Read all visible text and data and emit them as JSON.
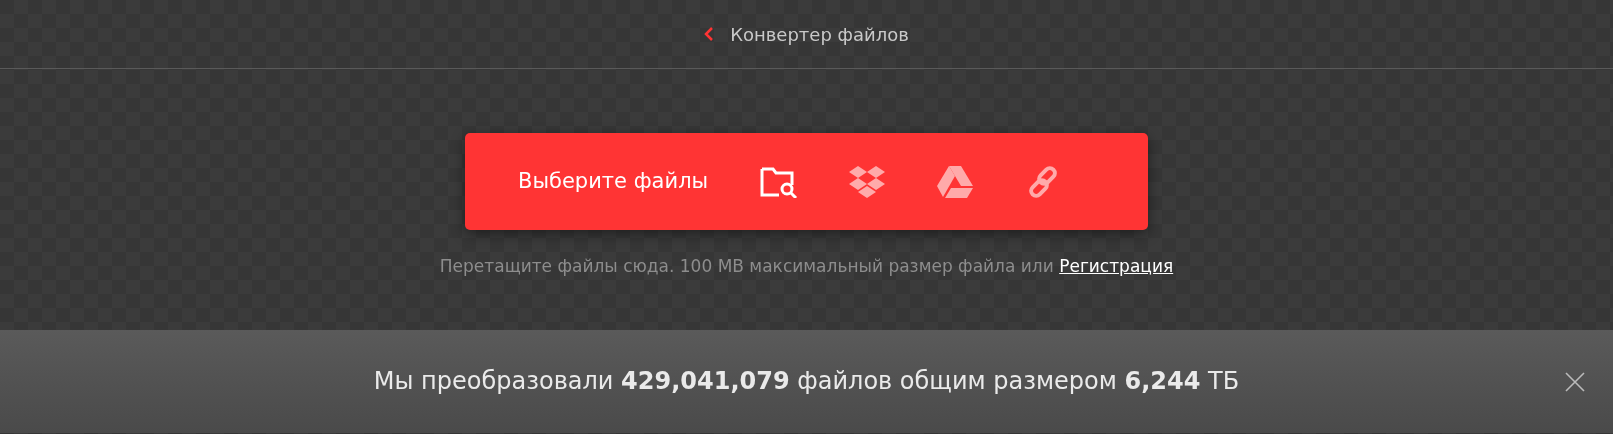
{
  "header": {
    "back_link": "Конвертер файлов"
  },
  "upload": {
    "button": "Выберите файлы",
    "hint": "Перетащите файлы сюда. 100 MB максимальный размер файла или",
    "hint_link": "Регистрация"
  },
  "stats_bar": {
    "text": "Мы преобразовали **429,041,079** файлов общим размером **6,244** ТБ"
  }
}
